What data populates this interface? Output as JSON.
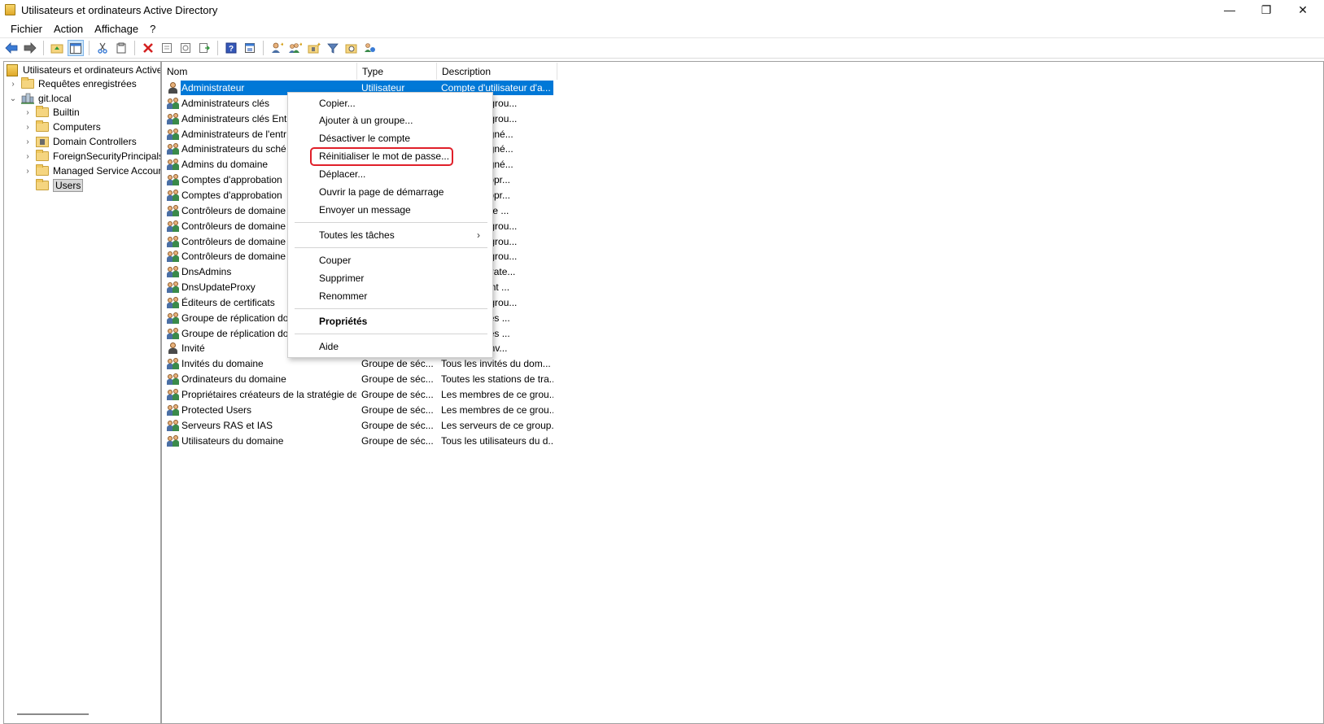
{
  "window": {
    "title": "Utilisateurs et ordinateurs Active Directory",
    "minimize_glyph": "—",
    "maximize_glyph": "❐",
    "close_glyph": "✕"
  },
  "menubar": {
    "items": [
      "Fichier",
      "Action",
      "Affichage",
      "?"
    ]
  },
  "toolbar": {
    "icons": [
      "back-arrow-icon",
      "forward-arrow-icon",
      "up-folder-icon",
      "show-hide-console-tree-icon",
      "cut-icon",
      "copy-icon",
      "delete-icon",
      "properties-icon",
      "refresh-icon",
      "export-list-icon",
      "help-icon",
      "console-help-icon",
      "new-user-icon",
      "new-group-icon",
      "new-ou-icon",
      "filter-icon",
      "find-icon",
      "add-to-group-icon"
    ]
  },
  "tree": {
    "root": "Utilisateurs et ordinateurs Active",
    "saved_queries": "Requêtes enregistrées",
    "domain": "git.local",
    "children": [
      "Builtin",
      "Computers",
      "Domain Controllers",
      "ForeignSecurityPrincipals",
      "Managed Service Accour",
      "Users"
    ],
    "selected": "Users"
  },
  "list": {
    "columns": [
      "Nom",
      "Type",
      "Description"
    ],
    "rows": [
      {
        "name": "Administrateur",
        "type": "Utilisateur",
        "desc": "Compte d'utilisateur d'a...",
        "icon": "user"
      },
      {
        "name": "Administrateurs clés",
        "type": "",
        "desc": "ores de ce grou...",
        "icon": "group"
      },
      {
        "name": "Administrateurs clés Ent",
        "type": "",
        "desc": "ores de ce grou...",
        "icon": "group"
      },
      {
        "name": "Administrateurs de l'entr",
        "type": "",
        "desc": "ateurs désigné...",
        "icon": "group"
      },
      {
        "name": "Administrateurs du sché",
        "type": "",
        "desc": "ateurs désigné...",
        "icon": "group"
      },
      {
        "name": "Admins du domaine",
        "type": "",
        "desc": "ateurs désigné...",
        "icon": "group"
      },
      {
        "name": "Comptes d'approbation",
        "type": "",
        "desc": "omptes d'appr...",
        "icon": "group"
      },
      {
        "name": "Comptes d'approbation",
        "type": "",
        "desc": "omptes d'appr...",
        "icon": "group"
      },
      {
        "name": "Contrôleurs de domaine",
        "type": "",
        "desc": "ontrôleurs de ...",
        "icon": "group"
      },
      {
        "name": "Contrôleurs de domaine",
        "type": "",
        "desc": "ores de ce grou...",
        "icon": "group"
      },
      {
        "name": "Contrôleurs de domaine",
        "type": "",
        "desc": "ores de ce grou...",
        "icon": "group"
      },
      {
        "name": "Contrôleurs de domaine",
        "type": "",
        "desc": "ores de ce grou...",
        "icon": "group"
      },
      {
        "name": "DnsAdmins",
        "type": "",
        "desc": "es administrate...",
        "icon": "group"
      },
      {
        "name": "DnsUpdateProxy",
        "type": "",
        "desc": "DNS qui sont ...",
        "icon": "group"
      },
      {
        "name": "Éditeurs de certificats",
        "type": "",
        "desc": "ores de ce grou...",
        "icon": "group"
      },
      {
        "name": "Groupe de réplication do",
        "type": "",
        "desc": "de passe des ...",
        "icon": "group"
      },
      {
        "name": "Groupe de réplication do",
        "type": "",
        "desc": "de passe des ...",
        "icon": "group"
      },
      {
        "name": "Invité",
        "type": "",
        "desc": "'utilisateur inv...",
        "icon": "user"
      },
      {
        "name": "Invités du domaine",
        "type": "Groupe de séc...",
        "desc": "Tous les invités du dom...",
        "icon": "group"
      },
      {
        "name": "Ordinateurs du domaine",
        "type": "Groupe de séc...",
        "desc": "Toutes les stations de tra...",
        "icon": "group"
      },
      {
        "name": "Propriétaires créateurs de la stratégie de...",
        "type": "Groupe de séc...",
        "desc": "Les membres de ce grou...",
        "icon": "group"
      },
      {
        "name": "Protected Users",
        "type": "Groupe de séc...",
        "desc": "Les membres de ce grou...",
        "icon": "group"
      },
      {
        "name": "Serveurs RAS et IAS",
        "type": "Groupe de séc...",
        "desc": "Les serveurs de ce group...",
        "icon": "group"
      },
      {
        "name": "Utilisateurs du domaine",
        "type": "Groupe de séc...",
        "desc": "Tous les utilisateurs du d...",
        "icon": "group"
      }
    ]
  },
  "context_menu": {
    "items": [
      {
        "label": "Copier...",
        "name": "ctx-copy"
      },
      {
        "label": "Ajouter à un groupe...",
        "name": "ctx-add-to-group"
      },
      {
        "label": "Désactiver le compte",
        "name": "ctx-disable-account"
      },
      {
        "label": "Réinitialiser le mot de passe...",
        "name": "ctx-reset-password"
      },
      {
        "label": "Déplacer...",
        "name": "ctx-move"
      },
      {
        "label": "Ouvrir la page de démarrage",
        "name": "ctx-open-home-page"
      },
      {
        "label": "Envoyer un message",
        "name": "ctx-send-mail"
      },
      {
        "label": "Toutes les tâches",
        "name": "ctx-all-tasks"
      },
      {
        "label": "Couper",
        "name": "ctx-cut"
      },
      {
        "label": "Supprimer",
        "name": "ctx-delete"
      },
      {
        "label": "Renommer",
        "name": "ctx-rename"
      },
      {
        "label": "Propriétés",
        "name": "ctx-properties"
      },
      {
        "label": "Aide",
        "name": "ctx-help"
      }
    ],
    "submenu_arrow": "›",
    "highlight_color": "#e0202a"
  },
  "colors": {
    "selection": "#0078d7",
    "accent_highlight": "#e0202a"
  }
}
